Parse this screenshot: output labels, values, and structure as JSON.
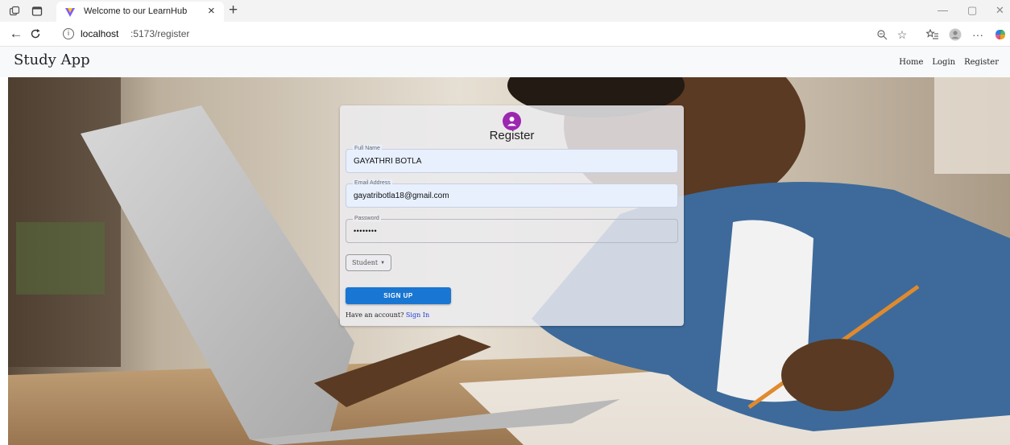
{
  "browser": {
    "tab_title": "Welcome to our LearnHub",
    "tab_close": "×",
    "new_tab": "+",
    "url_host": "localhost",
    "url_path": ":5173/register",
    "window_minimize": "—",
    "window_restore": "▢",
    "window_close": "✕",
    "more_tools": "···"
  },
  "navbar": {
    "brand": "Study App",
    "links": [
      "Home",
      "Login",
      "Register"
    ]
  },
  "form": {
    "title": "Register",
    "full_name": {
      "label": "Full Name",
      "value": "GAYATHRI BOTLA"
    },
    "email": {
      "label": "Email Address",
      "value": "gayatribotla18@gmail.com"
    },
    "password": {
      "label": "Password",
      "value": "••••••••"
    },
    "role": {
      "selected": "Student"
    },
    "submit_label": "SIGN UP",
    "signin_prompt": "Have an account?",
    "signin_link": "Sign In"
  },
  "colors": {
    "primary_button": "#1976d2",
    "avatar": "#9c27b0",
    "link": "#1a3fd1",
    "navbar_bg": "#f8f9fa"
  }
}
